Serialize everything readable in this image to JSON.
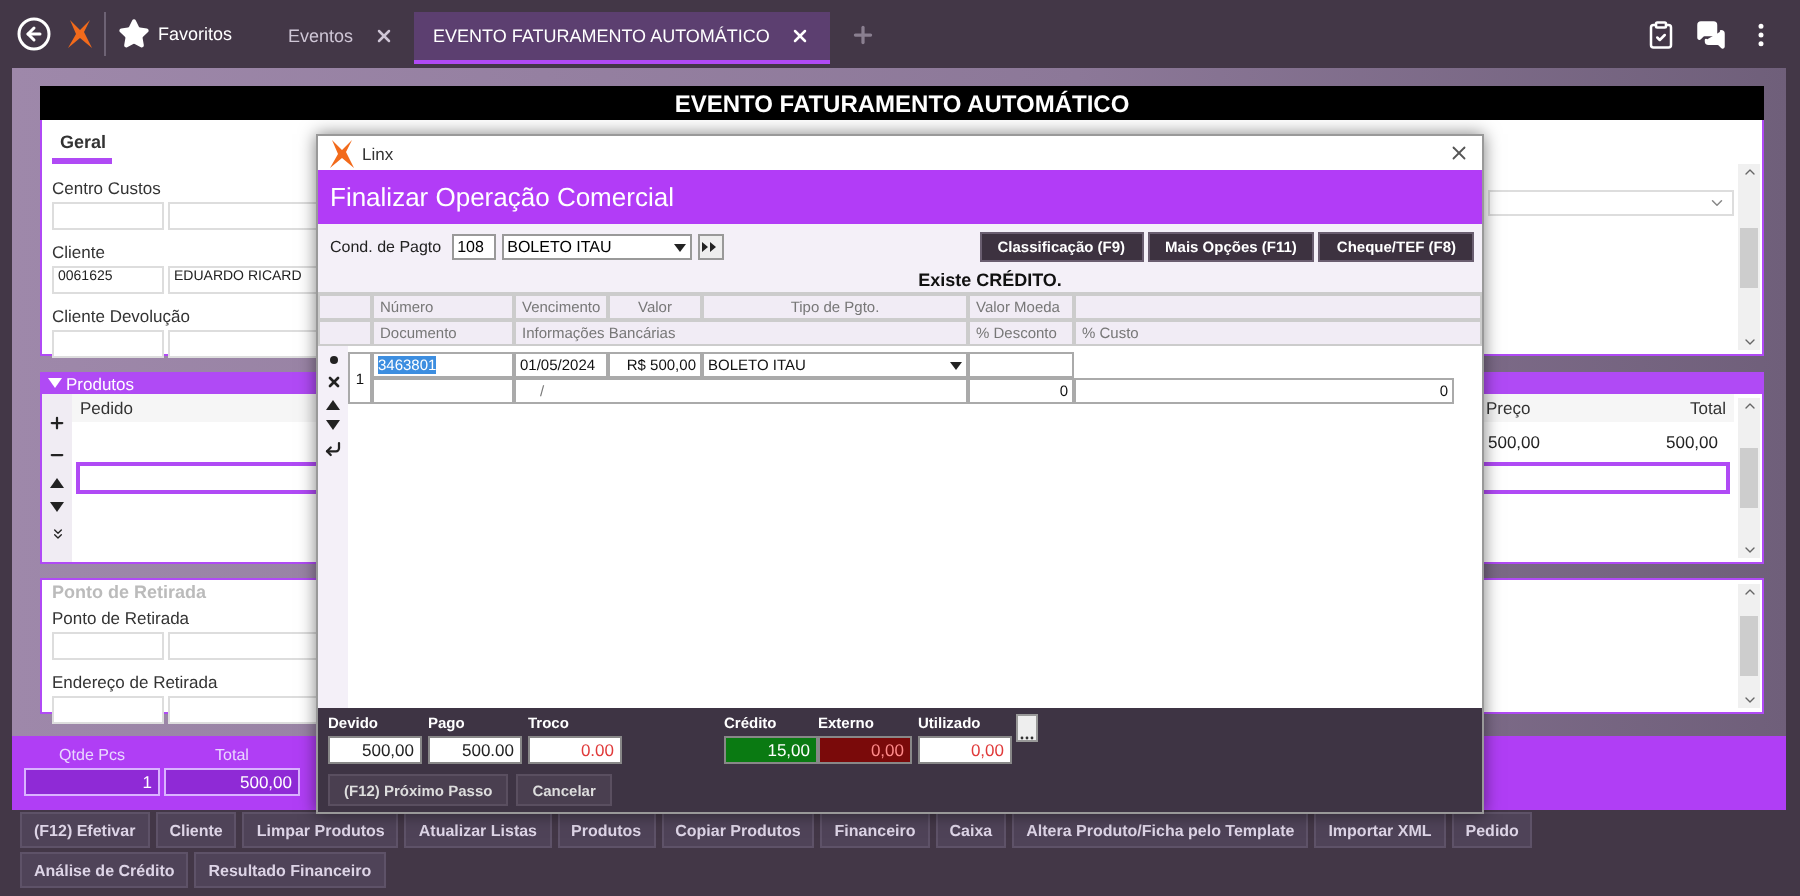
{
  "top_bar": {
    "favorites": "Favoritos",
    "tabs": [
      {
        "label": "Eventos",
        "selected": false
      },
      {
        "label": "EVENTO FATURAMENTO AUTOMÁTICO",
        "selected": true
      }
    ]
  },
  "form": {
    "title": "EVENTO FATURAMENTO AUTOMÁTICO",
    "section_tab": "Geral",
    "fields": [
      {
        "label": "Centro Custos"
      },
      {
        "label": "Cliente",
        "code": "0061625",
        "name": "EDUARDO RICARD"
      },
      {
        "label": "Cliente Devolução"
      }
    ]
  },
  "produtos": {
    "title": "Produtos",
    "columns": [
      "Pedido",
      "Preço",
      "Total"
    ],
    "rows": [
      {
        "preco": "500,00",
        "total": "500,00",
        "selected": false
      },
      {
        "selected": true
      }
    ]
  },
  "retirada": {
    "legend": "Ponto de Retirada",
    "fields": [
      "Ponto de Retirada",
      "Endereço de Retirada"
    ]
  },
  "totals": [
    {
      "label": "Qtde Pcs",
      "value": "1"
    },
    {
      "label": "Total",
      "value": "500,00"
    }
  ],
  "actions": [
    "(F12) Efetivar",
    "Cliente",
    "Limpar Produtos",
    "Atualizar Listas",
    "Produtos",
    "Copiar Produtos",
    "Financeiro",
    "Caixa",
    "Altera Produto/Ficha pelo Template",
    "Importar XML",
    "Pedido",
    "Análise de Crédito",
    "Resultado Financeiro"
  ],
  "dialog": {
    "window_title": "Linx",
    "heading": "Finalizar Operação Comercial",
    "payment_condition": {
      "label": "Cond. de Pagto",
      "code": "108",
      "name": "BOLETO ITAU"
    },
    "buttons": [
      "Classificação (F9)",
      "Mais Opções (F11)",
      "Cheque/TEF (F8)"
    ],
    "notice": "Existe CRÉDITO.",
    "header_top": [
      "Número",
      "Vencimento",
      "Valor",
      "Tipo de Pgto.",
      "Valor Moeda"
    ],
    "header_bottom": [
      "Documento",
      "Informações Bancárias",
      "% Desconto",
      "% Custo"
    ],
    "installments": [
      {
        "index": "1",
        "numero": "3463801",
        "selected": true,
        "vencimento": "01/05/2024",
        "valor": "R$ 500,00",
        "tipo": "BOLETO ITAU",
        "info": "/",
        "desconto": "0",
        "custo": "0"
      }
    ],
    "amounts": [
      {
        "label": "Devido",
        "value": "500,00",
        "kind": "plain"
      },
      {
        "label": "Pago",
        "value": "500.00",
        "kind": "plain"
      },
      {
        "label": "Troco",
        "value": "0.00",
        "kind": "warning"
      }
    ],
    "credit": [
      {
        "label": "Crédito",
        "value": "15,00",
        "kind": "credit"
      },
      {
        "label": "Externo",
        "value": "0,00",
        "kind": "debit"
      },
      {
        "label": "Utilizado",
        "value": "0,00",
        "kind": "warning"
      }
    ],
    "footer_buttons": [
      "(F12) Próximo Passo",
      "Cancelar"
    ]
  }
}
